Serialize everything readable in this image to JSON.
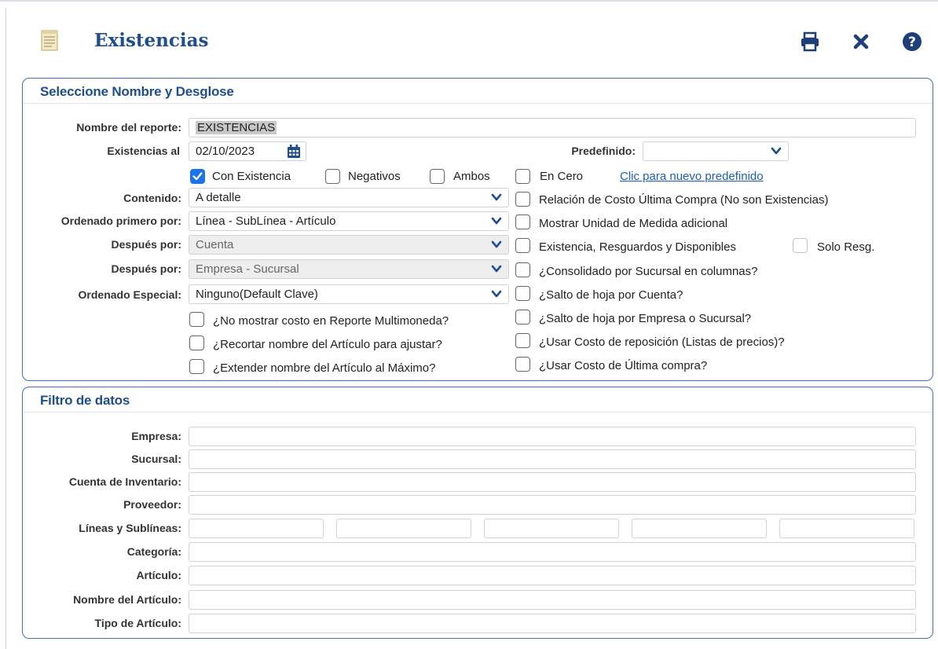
{
  "header": {
    "title": "Existencias",
    "icons": [
      "document-icon",
      "print-icon",
      "close-icon",
      "help-icon"
    ]
  },
  "section1": {
    "title": "Seleccione Nombre y Desglose",
    "report_name_label": "Nombre del reporte:",
    "report_name_value": "EXISTENCIAS",
    "date_label": "Existencias al",
    "date_value": "02/10/2023",
    "predefinido_label": "Predefinido:",
    "predefinido_value": "",
    "new_predefined_link": "Clic para nuevo predefinido",
    "filters": [
      {
        "label": "Con Existencia",
        "checked": true
      },
      {
        "label": "Negativos",
        "checked": false
      },
      {
        "label": "Ambos",
        "checked": false
      },
      {
        "label": "En Cero",
        "checked": false
      }
    ],
    "contenido_label": "Contenido:",
    "contenido_value": "A detalle",
    "ordenado_label": "Ordenado primero por:",
    "ordenado_value": "Línea - SubLínea - Artículo",
    "despues1_label": "Después por:",
    "despues1_value": "Cuenta",
    "despues2_label": "Después por:",
    "despues2_value": "Empresa - Sucursal",
    "especial_label": "Ordenado Especial:",
    "especial_value": "Ninguno(Default Clave)",
    "left_options": [
      {
        "label": "¿No mostrar costo en Reporte Multimoneda?",
        "checked": false
      },
      {
        "label": "¿Recortar nombre del Artículo para ajustar?",
        "checked": false
      },
      {
        "label": "¿Extender nombre del Artículo al Máximo?",
        "checked": false
      }
    ],
    "right_options": [
      {
        "label": "Relación de Costo Última Compra (No son Existencias)",
        "checked": false
      },
      {
        "label": "Mostrar Unidad de Medida adicional",
        "checked": false
      },
      {
        "label": "Existencia, Resguardos y Disponibles",
        "checked": false
      },
      {
        "label": "¿Consolidado por Sucursal en columnas?",
        "checked": false
      },
      {
        "label": "¿Salto de hoja por Cuenta?",
        "checked": false
      },
      {
        "label": "¿Salto de hoja por Empresa o Sucursal?",
        "checked": false
      },
      {
        "label": "¿Usar Costo de reposición (Listas de precios)?",
        "checked": false
      },
      {
        "label": "¿Usar Costo de Última compra?",
        "checked": false
      }
    ],
    "solo_resg_label": "Solo Resg."
  },
  "section2": {
    "title": "Filtro de datos",
    "fields": [
      {
        "label": "Empresa:",
        "value": ""
      },
      {
        "label": "Sucursal:",
        "value": ""
      },
      {
        "label": "Cuenta de Inventario:",
        "value": ""
      },
      {
        "label": "Proveedor:",
        "value": ""
      },
      {
        "label": "Líneas y Sublíneas:",
        "value": ""
      },
      {
        "label": "Categoría:",
        "value": ""
      },
      {
        "label": "Artículo:",
        "value": ""
      },
      {
        "label": "Nombre del Artículo:",
        "value": ""
      },
      {
        "label": "Tipo de Artículo:",
        "value": ""
      }
    ]
  },
  "colors": {
    "accent": "#1f4e8c",
    "border": "#3b6fbf",
    "checkbox_checked": "#1a73e8",
    "link": "#1a5fb4"
  }
}
